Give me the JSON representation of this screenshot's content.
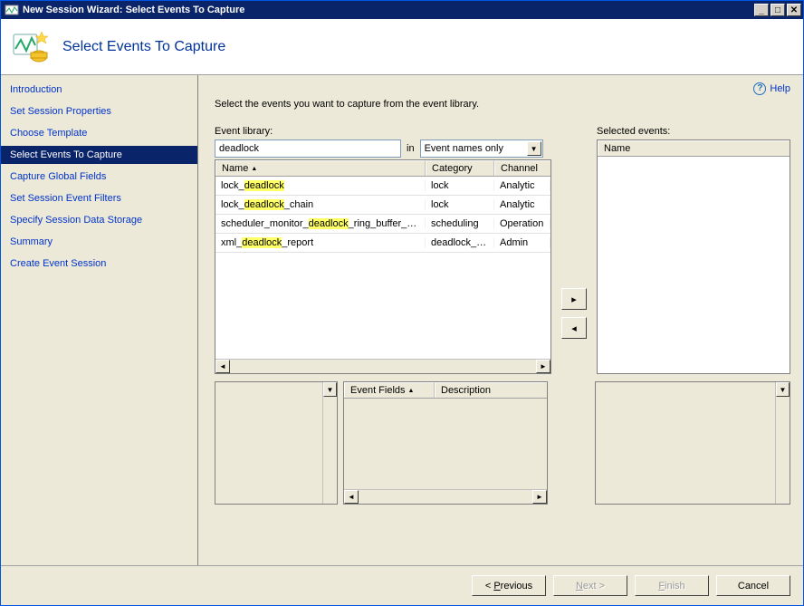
{
  "title": "New Session Wizard: Select Events To Capture",
  "header_title": "Select Events To Capture",
  "help_label": "Help",
  "instruction": "Select the events you want to capture from the event library.",
  "sidebar": {
    "items": [
      {
        "label": "Introduction",
        "selected": false
      },
      {
        "label": "Set Session Properties",
        "selected": false
      },
      {
        "label": "Choose Template",
        "selected": false
      },
      {
        "label": "Select Events To Capture",
        "selected": true
      },
      {
        "label": "Capture Global Fields",
        "selected": false
      },
      {
        "label": "Set Session Event Filters",
        "selected": false
      },
      {
        "label": "Specify Session Data Storage",
        "selected": false
      },
      {
        "label": "Summary",
        "selected": false
      },
      {
        "label": "Create Event Session",
        "selected": false
      }
    ]
  },
  "library": {
    "label": "Event library:",
    "filter_value": "deadlock",
    "in_label": "in",
    "scope_value": "Event names only",
    "columns": {
      "name": "Name",
      "category": "Category",
      "channel": "Channel"
    },
    "rows": [
      {
        "name_pre": "lock_",
        "name_hl": "deadlock",
        "name_post": "",
        "category": "lock",
        "channel": "Analytic"
      },
      {
        "name_pre": "lock_",
        "name_hl": "deadlock",
        "name_post": "_chain",
        "category": "lock",
        "channel": "Analytic"
      },
      {
        "name_pre": "scheduler_monitor_",
        "name_hl": "deadlock",
        "name_post": "_ring_buffer_recor...",
        "category": "scheduling",
        "channel": "Operation"
      },
      {
        "name_pre": "xml_",
        "name_hl": "deadlock",
        "name_post": "_report",
        "category": "deadlock_mo...",
        "channel": "Admin"
      }
    ]
  },
  "selected": {
    "label": "Selected events:",
    "columns": {
      "name": "Name"
    }
  },
  "detail": {
    "cols": {
      "event_fields": "Event Fields",
      "description": "Description"
    }
  },
  "footer": {
    "previous": "Previous",
    "next": "Next >",
    "finish": "Finish",
    "cancel": "Cancel"
  }
}
